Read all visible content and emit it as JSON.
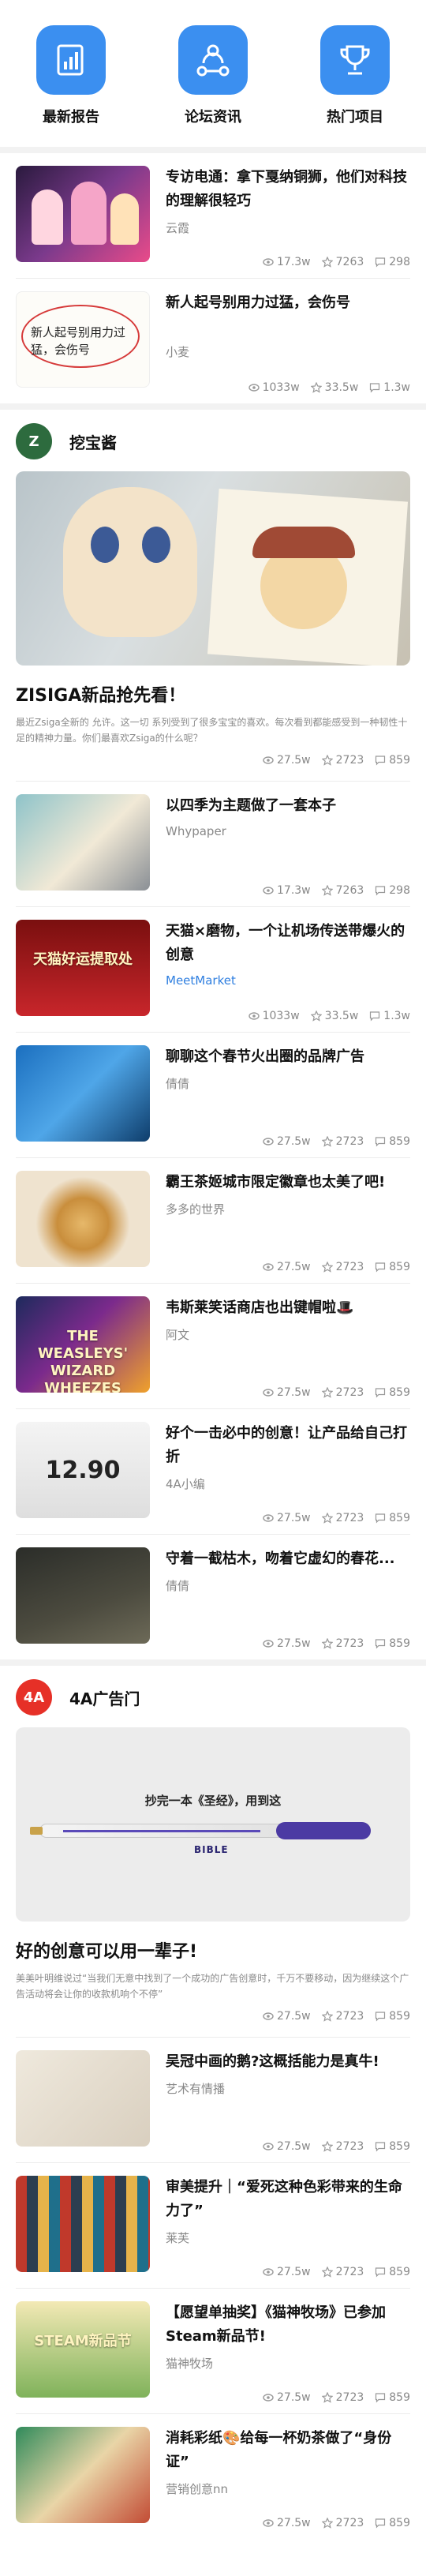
{
  "nav": [
    {
      "label": "最新报告",
      "icon": "report-chart-icon"
    },
    {
      "label": "论坛资讯",
      "icon": "forum-network-icon"
    },
    {
      "label": "热门项目",
      "icon": "trophy-icon"
    }
  ],
  "colors": {
    "accent": "#3b8ff0",
    "section1": "#2d6b3e",
    "section2": "#e63027"
  },
  "top_items": [
    {
      "title": "专访电通：拿下戛纳铜狮，他们对科技的理解很轻巧",
      "source": "云霞",
      "views": "17.3w",
      "stars": "7263",
      "comments": "298"
    },
    {
      "title": "新人起号别用力过猛，会伤号",
      "source": "小麦",
      "thumb_text": "新人起号别用力过猛，会伤号",
      "views": "1033w",
      "stars": "33.5w",
      "comments": "1.3w"
    }
  ],
  "section1": {
    "logo": "Z",
    "title": "挖宝酱",
    "feature": {
      "title": "ZISIGA新品抢先看！",
      "desc": "最近Zsiga全新的 允许。这一切 系列受到了很多宝宝的喜欢。每次看到都能感受到一种韧性十足的精神力量。你们最喜欢Zsiga的什么呢？",
      "views": "27.5w",
      "stars": "2723",
      "comments": "859"
    },
    "items": [
      {
        "title": "以四季为主题做了一套本子",
        "source": "Whypaper",
        "views": "17.3w",
        "stars": "7263",
        "comments": "298"
      },
      {
        "title": "天猫×磨物，一个让机场传送带爆火的创意",
        "source": "MeetMarket",
        "source_blue": true,
        "thumb_text": "天猫好运提取处",
        "views": "1033w",
        "stars": "33.5w",
        "comments": "1.3w"
      },
      {
        "title": "聊聊这个春节火出圈的品牌广告",
        "source": "倩倩",
        "views": "27.5w",
        "stars": "2723",
        "comments": "859"
      },
      {
        "title": "霸王茶姬城市限定徽章也太美了吧!",
        "source": "多多的世界",
        "views": "27.5w",
        "stars": "2723",
        "comments": "859"
      },
      {
        "title": "韦斯莱笑话商店也出键帽啦🎩",
        "source": "阿文",
        "thumb_text": "THE WEASLEYS' WIZARD WHEEZES",
        "views": "27.5w",
        "stars": "2723",
        "comments": "859"
      },
      {
        "title": "好个一击必中的创意！让产品给自己打折",
        "source": "4A小编",
        "thumb_text": "12.90",
        "views": "27.5w",
        "stars": "2723",
        "comments": "859"
      },
      {
        "title": "守着一截枯木，吻着它虚幻的春花...",
        "source": "倩倩",
        "views": "27.5w",
        "stars": "2723",
        "comments": "859"
      }
    ]
  },
  "section2": {
    "logo": "4A",
    "title": "4A广告门",
    "feature": {
      "img_caption": "抄完一本《圣经》，用到这",
      "pen_text": "BIBLE",
      "title": "好的创意可以用一辈子!",
      "desc": "美美叶明维说过“当我们无意中找到了一个成功的广告创意时，千万不要移动，因为继续这个广告活动将会让你的收款机响个不停”",
      "views": "27.5w",
      "stars": "2723",
      "comments": "859"
    },
    "items": [
      {
        "title": "吴冠中画的鹅?这概括能力是真牛!",
        "source": "艺术有情播",
        "views": "27.5w",
        "stars": "2723",
        "comments": "859"
      },
      {
        "title": "审美提升｜“爱死这种色彩带来的生命力了”",
        "source": "莱芙",
        "views": "27.5w",
        "stars": "2723",
        "comments": "859"
      },
      {
        "title": "【愿望单抽奖】《猫神牧场》已参加Steam新品节!",
        "source": "猫神牧场",
        "thumb_text": "STEAM新品节",
        "views": "27.5w",
        "stars": "2723",
        "comments": "859"
      },
      {
        "title": "消耗彩纸🎨给每一杯奶茶做了“身份证”",
        "source": "营销创意nn",
        "views": "27.5w",
        "stars": "2723",
        "comments": "859"
      }
    ]
  }
}
